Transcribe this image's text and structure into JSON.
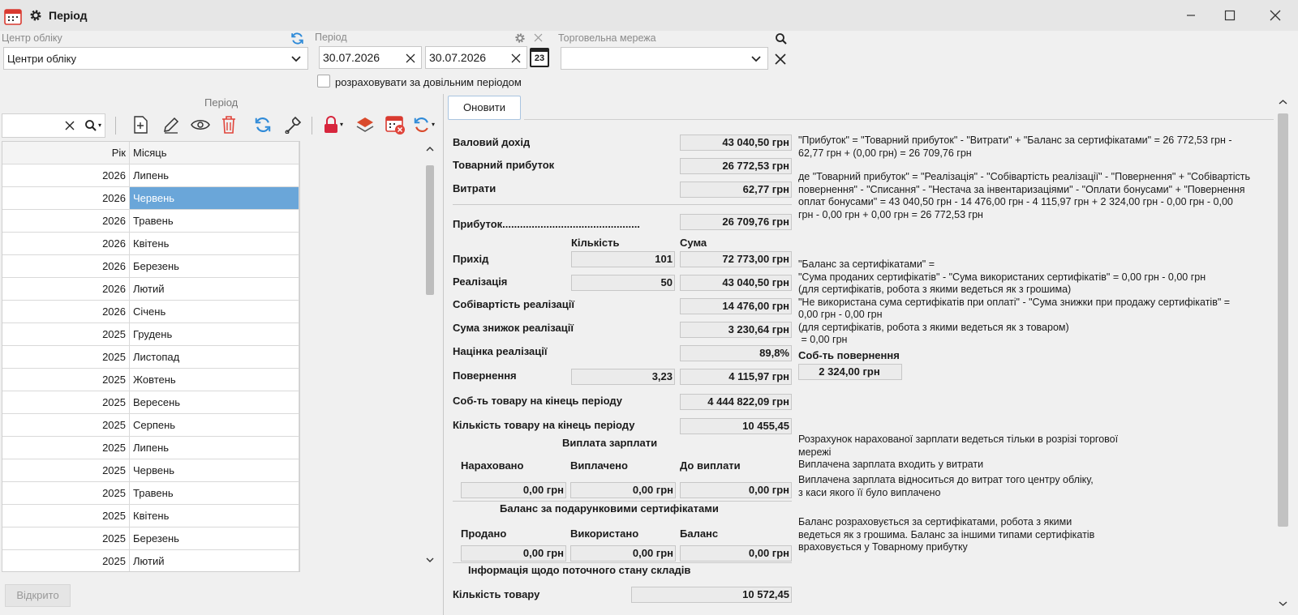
{
  "window": {
    "title": "Період"
  },
  "filters": {
    "center_label": "Центр обліку",
    "center_value": "Центри обліку",
    "period_label": "Період",
    "date_from": "30.07.2026",
    "date_to": "30.07.2026",
    "calendar_day": "23",
    "network_label": "Торговельна мережа",
    "network_value": "",
    "arbitrary_period_label": "розраховувати за довільним періодом"
  },
  "left": {
    "panel_title": "Період",
    "search_value": "",
    "col_year": "Рік",
    "col_month": "Місяць",
    "rows": [
      {
        "year": "2026",
        "month": "Липень"
      },
      {
        "year": "2026",
        "month": "Червень"
      },
      {
        "year": "2026",
        "month": "Травень"
      },
      {
        "year": "2026",
        "month": "Квітень"
      },
      {
        "year": "2026",
        "month": "Березень"
      },
      {
        "year": "2026",
        "month": "Лютий"
      },
      {
        "year": "2026",
        "month": "Січень"
      },
      {
        "year": "2025",
        "month": "Грудень"
      },
      {
        "year": "2025",
        "month": "Листопад"
      },
      {
        "year": "2025",
        "month": "Жовтень"
      },
      {
        "year": "2025",
        "month": "Вересень"
      },
      {
        "year": "2025",
        "month": "Серпень"
      },
      {
        "year": "2025",
        "month": "Липень"
      },
      {
        "year": "2025",
        "month": "Червень"
      },
      {
        "year": "2025",
        "month": "Травень"
      },
      {
        "year": "2025",
        "month": "Квітень"
      },
      {
        "year": "2025",
        "month": "Березень"
      },
      {
        "year": "2025",
        "month": "Лютий"
      }
    ],
    "status_button": "Відкрито"
  },
  "right": {
    "refresh_button": "Оновити",
    "gross_income_label": "Валовий дохід",
    "gross_income": "43 040,50 грн",
    "goods_profit_label": "Товарний прибуток",
    "goods_profit": "26 772,53 грн",
    "expenses_label": "Витрати",
    "expenses": "62,77 грн",
    "profit_label": "Прибуток...............................................",
    "profit": "26 709,76 грн",
    "qty_header": "Кількість",
    "sum_header": "Сума",
    "income_label": "Прихід",
    "income_qty": "101",
    "income_sum": "72 773,00 грн",
    "sales_label": "Реалізація",
    "sales_qty": "50",
    "sales_sum": "43 040,50 грн",
    "cost_label": "Собівартість реалізації",
    "cost": "14 476,00 грн",
    "discount_label": "Сума знижок реалізації",
    "discount": "3 230,64 грн",
    "markup_label": "Націнка реалізації",
    "markup": "89,8%",
    "returns_label": "Повернення",
    "returns_qty": "3,23",
    "returns_sum": "4 115,97 грн",
    "stock_cost_label": "Соб-ть товару на кінець періоду",
    "stock_cost": "4 444 822,09 грн",
    "stock_qty_label": "Кількість товару на кінець періоду",
    "stock_qty": "10 455,45",
    "salary_title": "Виплата зарплати",
    "accrued_label": "Нараховано",
    "paid_label": "Виплачено",
    "topay_label": "До виплати",
    "accrued": "0,00 грн",
    "paid": "0,00 грн",
    "topay": "0,00 грн",
    "cert_title": "Баланс за подарунковими сертифікатами",
    "sold_label": "Продано",
    "used_label": "Використано",
    "balance_label": "Баланс",
    "sold": "0,00 грн",
    "used": "0,00 грн",
    "balance": "0,00 грн",
    "wh_title": "Інформація щодо поточного стану складів",
    "wh_qty_label": "Кількість товару",
    "wh_qty": "10 572,45",
    "return_cost_label": "Соб-ть повернення",
    "return_cost": "2 324,00 грн",
    "note1": [
      "\"Прибуток\" = \"Товарний прибуток\" - \"Витрати\" + \"Баланс за сертифікатами\" = 26 772,53 грн -",
      "62,77 грн + (0,00 грн) = 26 709,76 грн"
    ],
    "note2": [
      "де \"Товарний прибуток\" = \"Реалізація\" - \"Собівартість реалізації\" - \"Повернення\" + \"Собівартість",
      "повернення\" - \"Списання\" - \"Нестача за інвентаризаціями\" - \"Оплати бонусами\" + \"Повернення",
      "оплат бонусами\" = 43 040,50 грн - 14 476,00 грн - 4 115,97 грн + 2 324,00 грн - 0,00 грн - 0,00",
      "грн - 0,00 грн + 0,00 грн = 26 772,53 грн"
    ],
    "note3": [
      "\"Баланс за сертифікатами\" =",
      "\"Сума проданих сертифікатів\" - \"Сума використаних сертифікатів\" = 0,00 грн - 0,00 грн",
      "(для сертифікатів, робота з якими ведеться як з грошима)",
      "\"Не використана сума сертифікатів при оплаті\" - \"Сума знижки при продажу сертифікатів\" =",
      "0,00 грн - 0,00 грн",
      "(для сертифікатів, робота з якими ведеться як з товаром)",
      " = 0,00 грн"
    ],
    "note4": [
      "Розрахунок нарахованої зарплати ведеться тільки в розрізі торгової",
      "мережі",
      "Виплачена зарплата входить у витрати"
    ],
    "note5": [
      "Виплачена зарплата відноситься до витрат того центру обліку,",
      "з каси якого її було виплачено"
    ],
    "note6": [
      "Баланс розраховується за сертифікатами, робота з якими",
      "ведеться як з грошима. Баланс за іншими типами сертифікатів",
      "враховується у Товарному прибутку"
    ]
  },
  "icons": [
    "calendar-app-icon",
    "gear-icon",
    "minimize-icon",
    "maximize-icon",
    "close-icon",
    "refresh-icon",
    "search-icon",
    "clear-icon",
    "chevron-down-icon",
    "new-document-icon",
    "edit-icon",
    "view-icon",
    "delete-icon",
    "wrench-icon",
    "lock-icon",
    "layers-icon",
    "calendar-close-icon"
  ],
  "colors": {
    "selection": "#6aa6d9",
    "delete_red": "#e0443a",
    "refresh_blue": "#2e8ad8",
    "lock_red": "#d7263d"
  }
}
